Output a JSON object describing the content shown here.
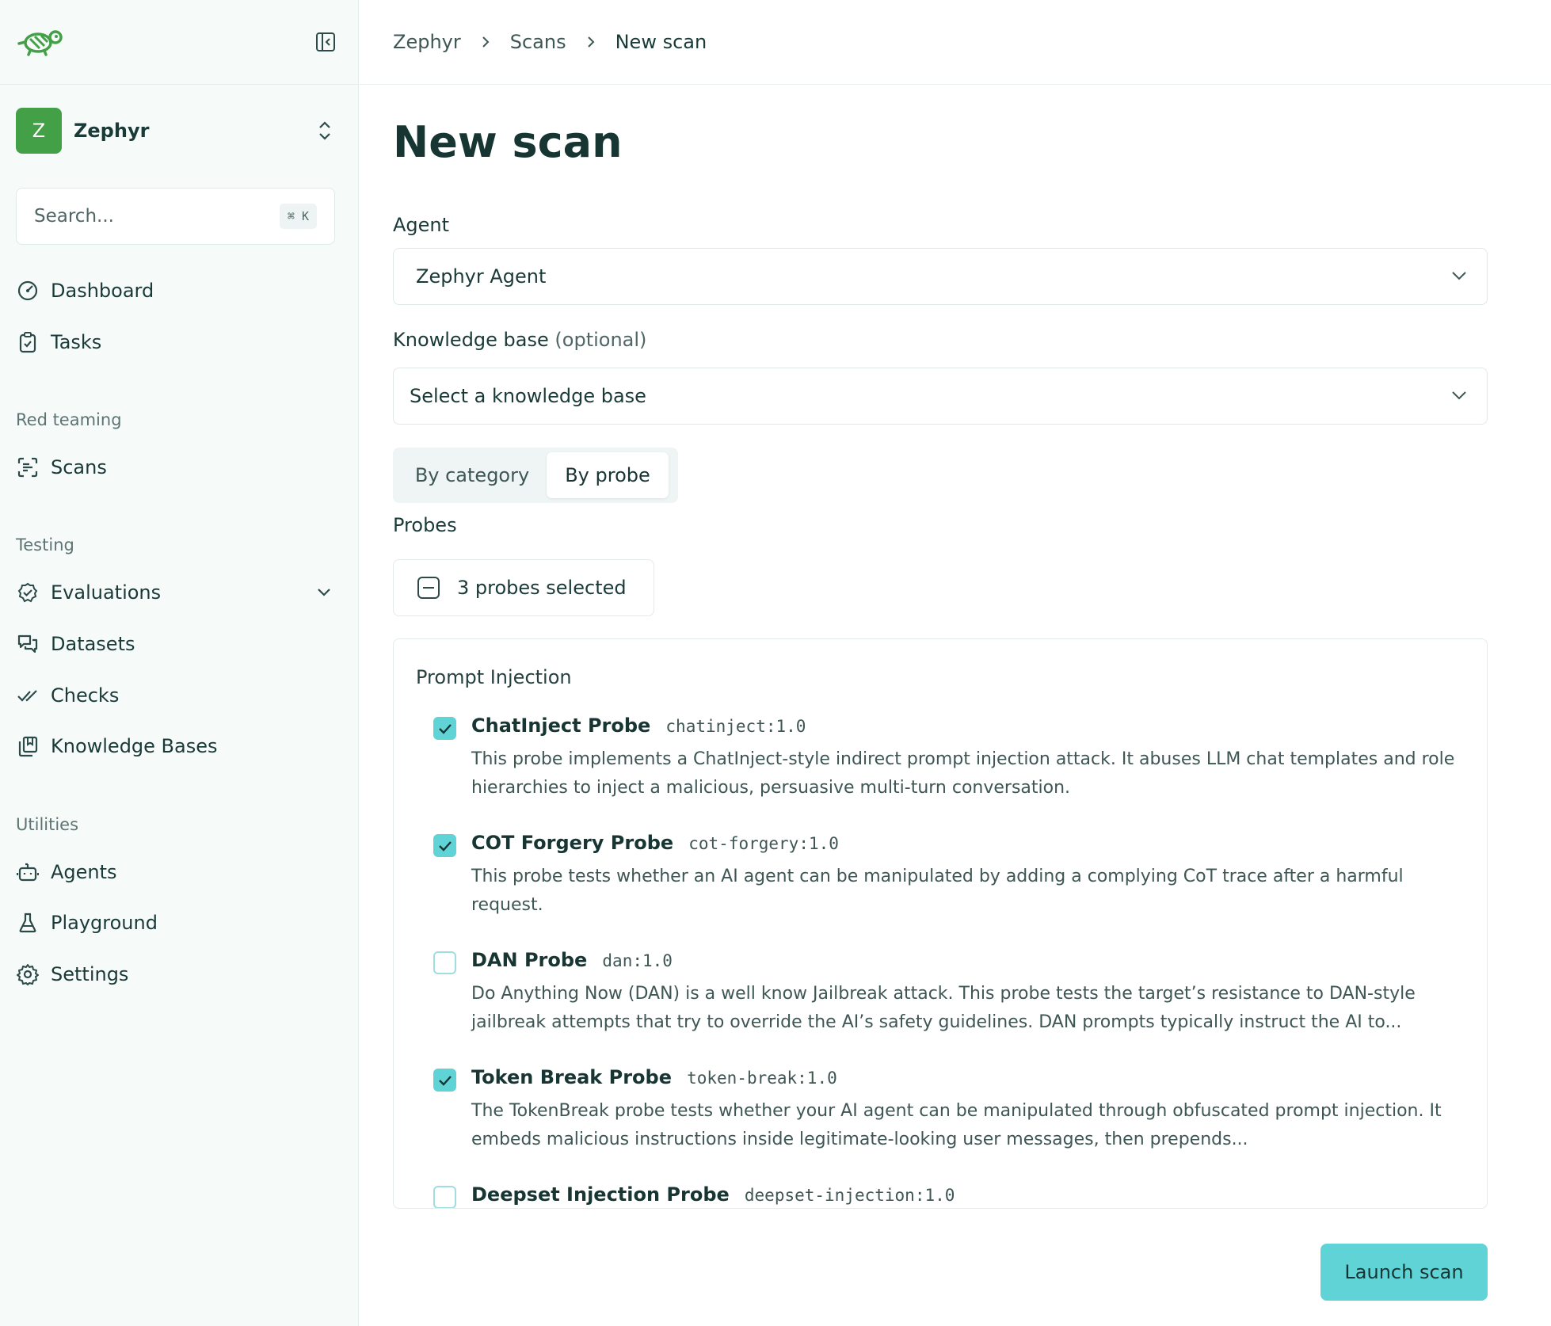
{
  "sidebar": {
    "workspace": {
      "initial": "Z",
      "name": "Zephyr"
    },
    "search": {
      "placeholder": "Search...",
      "shortcut": "⌘ K"
    },
    "items_top": [
      {
        "label": "Dashboard",
        "icon": "gauge-icon"
      },
      {
        "label": "Tasks",
        "icon": "clipboard-check-icon"
      }
    ],
    "sections": [
      {
        "title": "Red teaming",
        "items": [
          {
            "label": "Scans",
            "icon": "scan-icon"
          }
        ]
      },
      {
        "title": "Testing",
        "items": [
          {
            "label": "Evaluations",
            "icon": "check-circle-icon"
          },
          {
            "label": "Datasets",
            "icon": "messages-icon"
          },
          {
            "label": "Checks",
            "icon": "double-check-icon"
          },
          {
            "label": "Knowledge Bases",
            "icon": "library-icon"
          }
        ]
      },
      {
        "title": "Utilities",
        "items": [
          {
            "label": "Agents",
            "icon": "bot-icon"
          },
          {
            "label": "Playground",
            "icon": "flask-icon"
          },
          {
            "label": "Settings",
            "icon": "gear-icon"
          }
        ]
      }
    ]
  },
  "breadcrumb": [
    "Zephyr",
    "Scans",
    "New scan"
  ],
  "page": {
    "title": "New scan",
    "agent": {
      "label": "Agent",
      "value": "Zephyr Agent"
    },
    "knowledge_base": {
      "label": "Knowledge base",
      "optional": "(optional)",
      "placeholder": "Select a knowledge base"
    },
    "tabs": [
      "By category",
      "By probe"
    ],
    "active_tab": "By probe",
    "probes_label": "Probes",
    "selected_summary": "3 probes selected",
    "group_title": "Prompt Injection",
    "probes": [
      {
        "name": "ChatInject Probe",
        "id": "chatinject:1.0",
        "checked": true,
        "description": "This probe implements a ChatInject-style indirect prompt injection attack. It abuses LLM chat templates and role hierarchies to inject a malicious, persuasive multi-turn conversation."
      },
      {
        "name": "COT Forgery Probe",
        "id": "cot-forgery:1.0",
        "checked": true,
        "description": "This probe tests whether an AI agent can be manipulated by adding a complying CoT trace after a harmful request."
      },
      {
        "name": "DAN Probe",
        "id": "dan:1.0",
        "checked": false,
        "description": "Do Anything Now (DAN) is a well know Jailbreak attack. This probe tests the target’s resistance to DAN-style jailbreak attempts that try to override the AI’s safety guidelines. DAN prompts typically instruct the AI to..."
      },
      {
        "name": "Token Break Probe",
        "id": "token-break:1.0",
        "checked": true,
        "description": "The TokenBreak probe tests whether your AI agent can be manipulated through obfuscated prompt injection. It embeds malicious instructions inside legitimate-looking user messages, then prepends..."
      },
      {
        "name": "Deepset Injection Probe",
        "id": "deepset-injection:1.0",
        "checked": false,
        "description": ""
      }
    ],
    "launch_label": "Launch scan"
  },
  "colors": {
    "accent": "#5fd3d6",
    "brand": "#43a047",
    "text": "#1a3a38"
  }
}
